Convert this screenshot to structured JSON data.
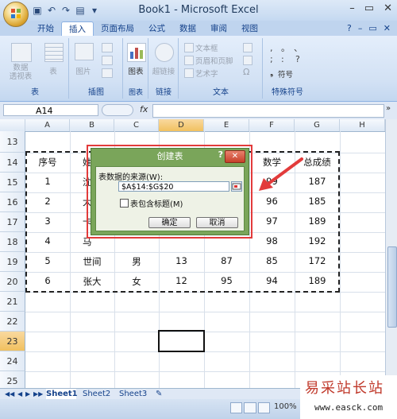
{
  "window": {
    "title": "Book1 - Microsoft Excel",
    "minimize": "–",
    "restore": "▭",
    "close": "✕"
  },
  "ribbon_tabs": [
    "开始",
    "插入",
    "页面布局",
    "公式",
    "数据",
    "审阅",
    "视图"
  ],
  "active_tab": "插入",
  "ribbon": {
    "groups": {
      "table": "表",
      "illustrations": "插图",
      "charts": "图表",
      "links": "链接",
      "text": "文本",
      "special": "特殊符号"
    },
    "buttons": {
      "pivot": "数据\n透视表",
      "table": "表",
      "picture": "图片",
      "chart": "图表",
      "hyperlink": "超链接",
      "textbox": "文本框",
      "header_footer": "页眉和页脚",
      "wordart": "艺术字",
      "symbol": "符号"
    }
  },
  "formula_bar": {
    "name_box": "A14",
    "fx": "fx",
    "value": ""
  },
  "columns": [
    "A",
    "B",
    "C",
    "D",
    "E",
    "F",
    "G",
    "H"
  ],
  "rows": [
    "13",
    "14",
    "15",
    "16",
    "17",
    "18",
    "19",
    "20",
    "21",
    "22",
    "23",
    "24",
    "25"
  ],
  "selected_column": "D",
  "selected_row": "23",
  "table": {
    "headers": [
      "序号",
      "姓",
      "",
      "",
      "",
      "数学",
      "总成绩"
    ],
    "rows": [
      [
        "1",
        "沈",
        "",
        "",
        "",
        "99",
        "187"
      ],
      [
        "2",
        "大",
        "",
        "",
        "",
        "96",
        "185"
      ],
      [
        "3",
        "卡",
        "",
        "",
        "",
        "97",
        "189"
      ],
      [
        "4",
        "马",
        "",
        "",
        "",
        "98",
        "192"
      ],
      [
        "5",
        "世间",
        "男",
        "13",
        "87",
        "85",
        "172"
      ],
      [
        "6",
        "张大",
        "女",
        "12",
        "95",
        "94",
        "189"
      ]
    ]
  },
  "dialog": {
    "title": "创建表",
    "help": "?",
    "close": "✕",
    "source_label": "表数据的来源(W):",
    "range": "$A$14:$G$20",
    "checkbox_label": "表包含标题(M)",
    "checkbox_checked": false,
    "ok": "确定",
    "cancel": "取消"
  },
  "sheets": [
    "Sheet1",
    "Sheet2",
    "Sheet3"
  ],
  "active_sheet": "Sheet1",
  "status": {
    "zoom": "100%"
  },
  "watermark": {
    "title": "易采站长站",
    "url": "www.easck.com"
  },
  "colors": {
    "accent": "#7aa55a",
    "highlight": "#e23b3b",
    "header_select": "#f1c15f"
  }
}
